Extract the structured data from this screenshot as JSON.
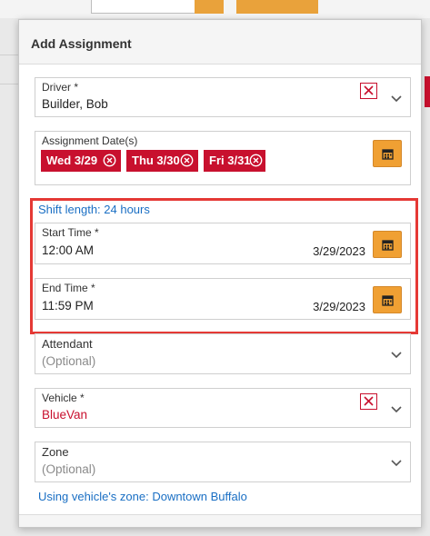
{
  "modal": {
    "title": "Add Assignment"
  },
  "driver": {
    "label": "Driver *",
    "value": "Builder, Bob"
  },
  "assignment_dates": {
    "label": "Assignment Date(s)",
    "chips": [
      "Wed 3/29",
      "Thu 3/30",
      "Fri 3/31"
    ]
  },
  "shift": {
    "length_text": "Shift length: 24 hours"
  },
  "start_time": {
    "label": "Start Time *",
    "time": "12:00 AM",
    "date": "3/29/2023"
  },
  "end_time": {
    "label": "End Time *",
    "time": "11:59 PM",
    "date": "3/29/2023"
  },
  "attendant": {
    "label": "Attendant",
    "placeholder": "(Optional)"
  },
  "vehicle": {
    "label": "Vehicle *",
    "value": "BlueVan"
  },
  "zone": {
    "label": "Zone",
    "placeholder": "(Optional)",
    "info": "Using vehicle's zone: Downtown Buffalo"
  },
  "colors": {
    "accent_red": "#c8102e",
    "calendar_button": "#f0a033",
    "link_blue": "#1a6fc4",
    "highlight_border": "#e53935"
  },
  "icons": [
    "close-box-icon",
    "chevron-down-icon",
    "calendar-icon",
    "chip-remove-icon"
  ]
}
